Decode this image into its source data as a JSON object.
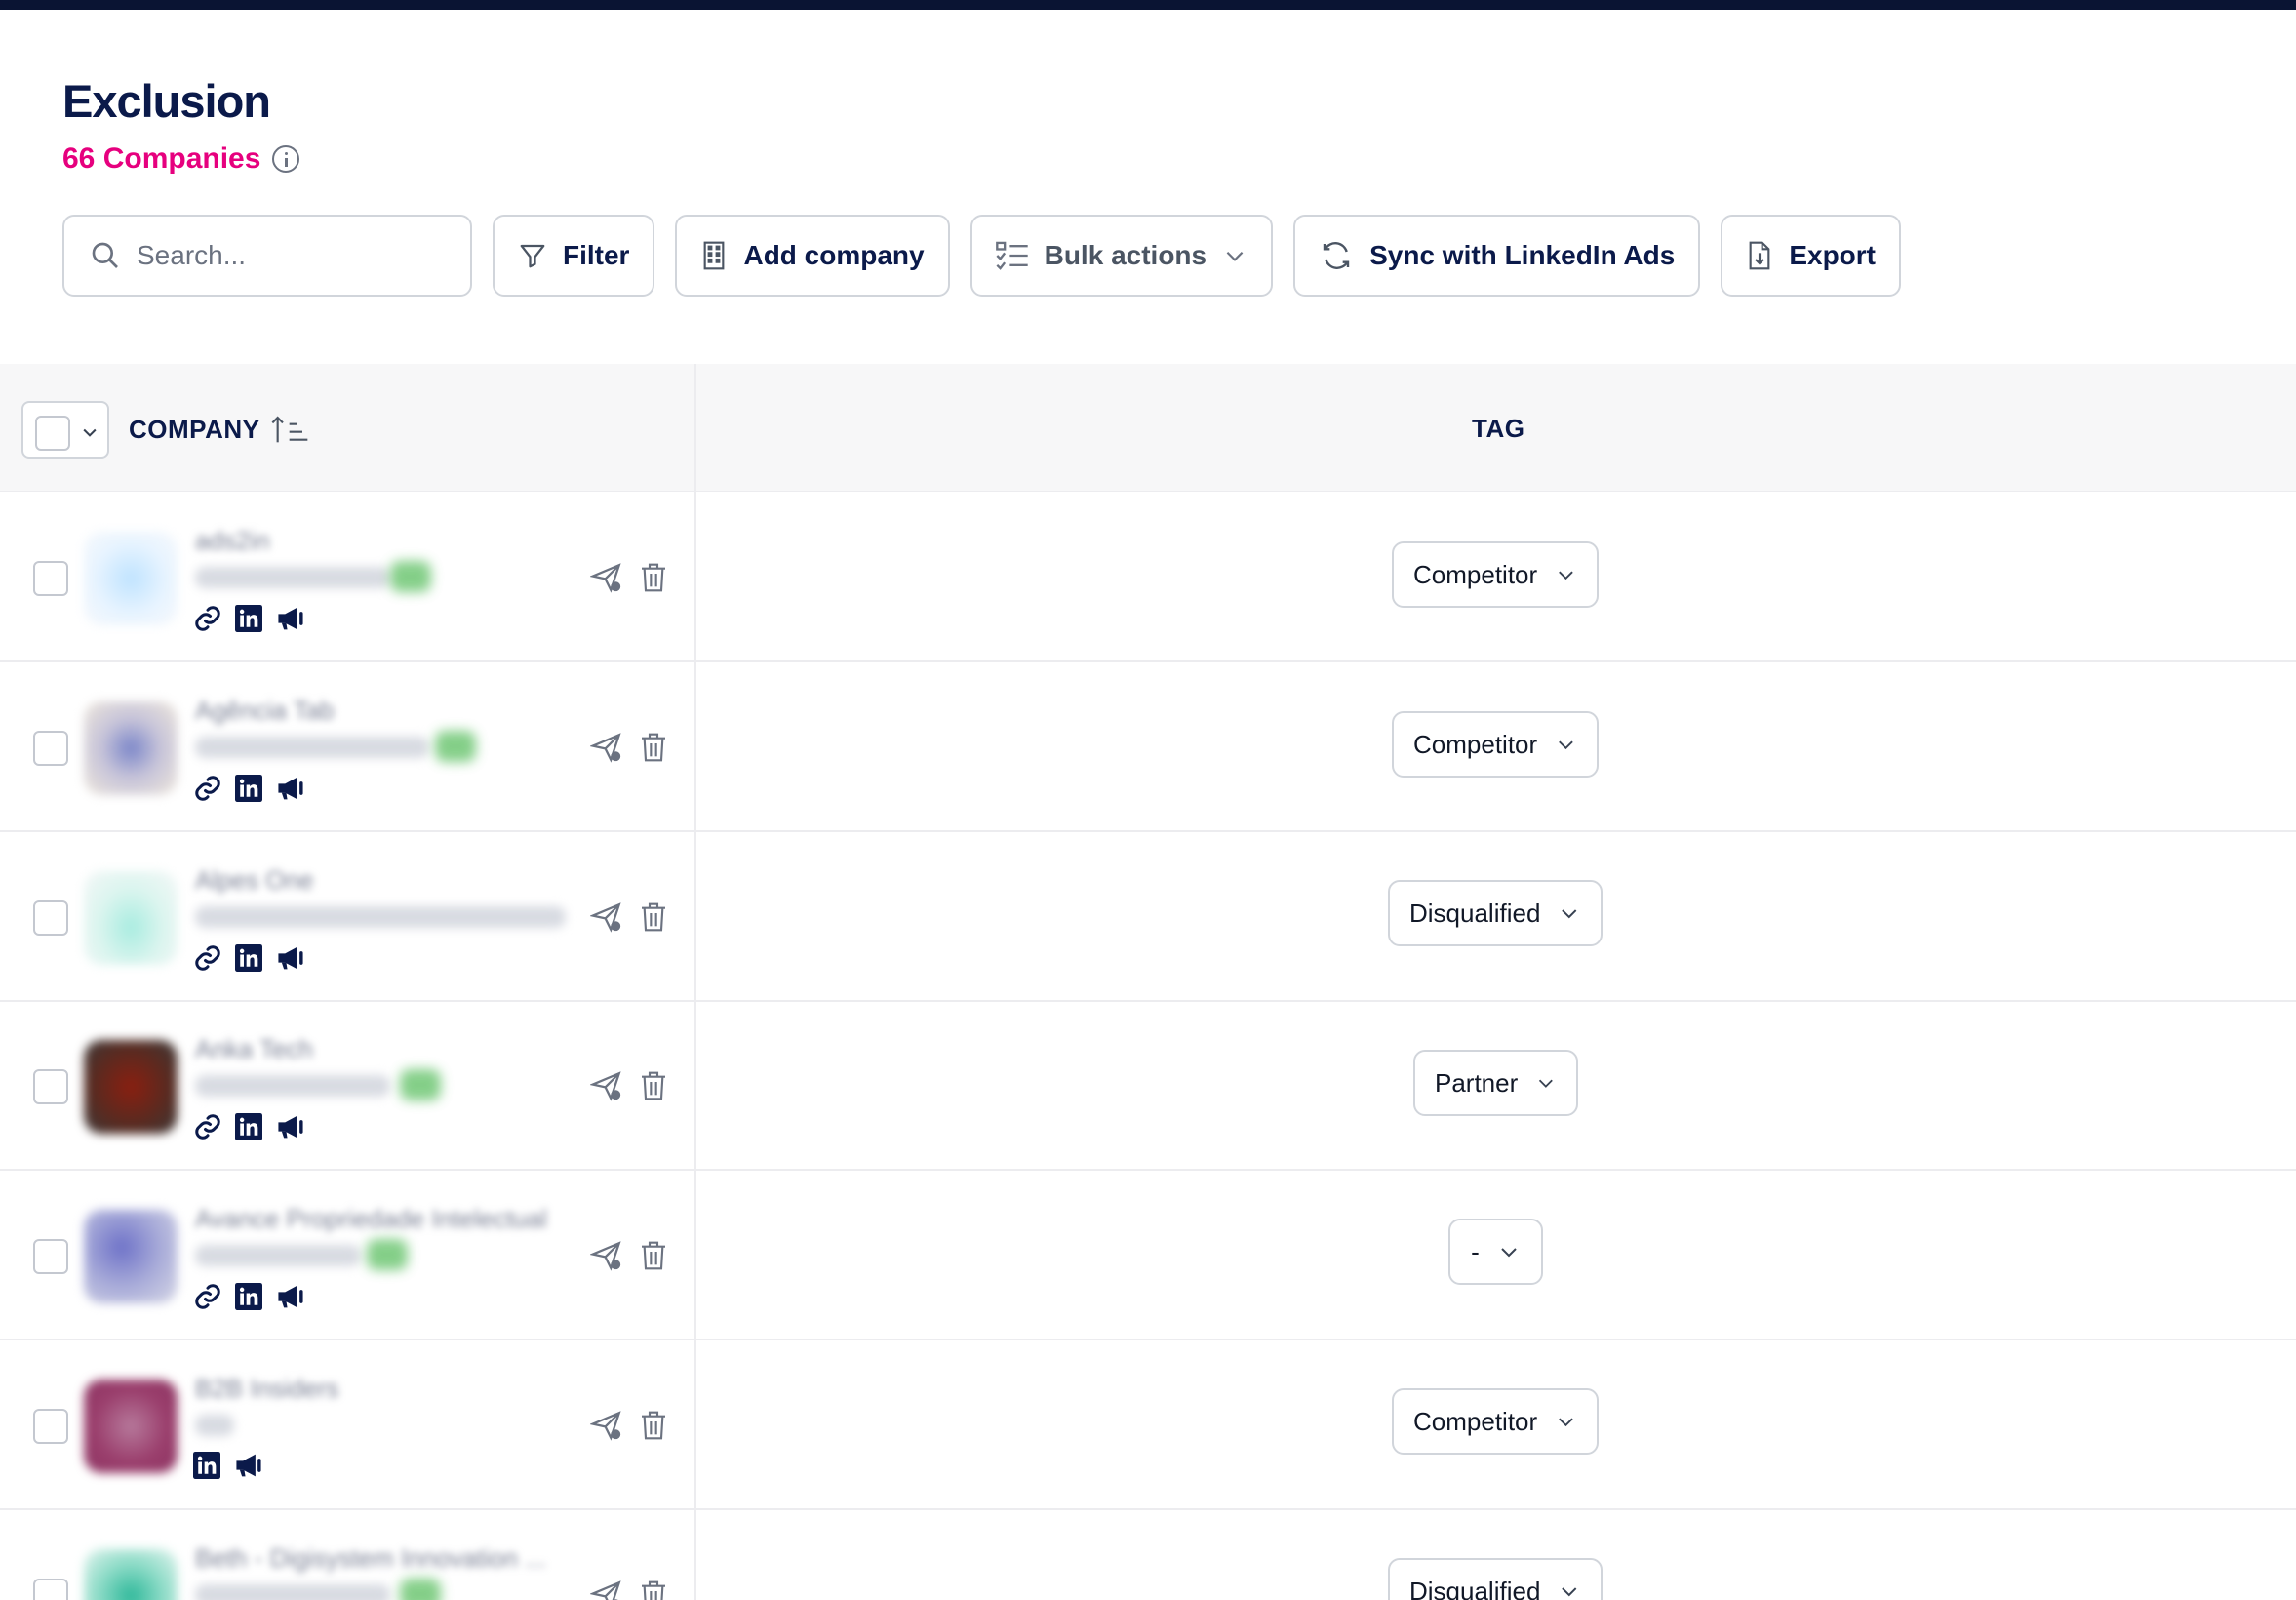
{
  "page": {
    "title": "Exclusion",
    "count": "66 Companies"
  },
  "toolbar": {
    "search_placeholder": "Search...",
    "filter": "Filter",
    "add_company": "Add company",
    "bulk_actions": "Bulk actions",
    "sync": "Sync with LinkedIn Ads",
    "export": "Export"
  },
  "table": {
    "columns": {
      "company": "COMPANY",
      "tag": "TAG"
    },
    "rows": [
      {
        "name": "ads2in",
        "tag": "Competitor"
      },
      {
        "name": "Agência Tab",
        "tag": "Competitor"
      },
      {
        "name": "Alpes One",
        "tag": "Disqualified"
      },
      {
        "name": "Anka Tech",
        "tag": "Partner"
      },
      {
        "name": "Avance Propriedade Intelectual",
        "tag": "-"
      },
      {
        "name": "B2B Insiders",
        "tag": "Competitor"
      },
      {
        "name": "Beth - Digisystem Innovation ...",
        "tag": "Disqualified"
      }
    ]
  },
  "colors": {
    "brand_navy": "#0b1a4a",
    "accent_pink": "#e6007e",
    "topbar": "#0a1433"
  }
}
